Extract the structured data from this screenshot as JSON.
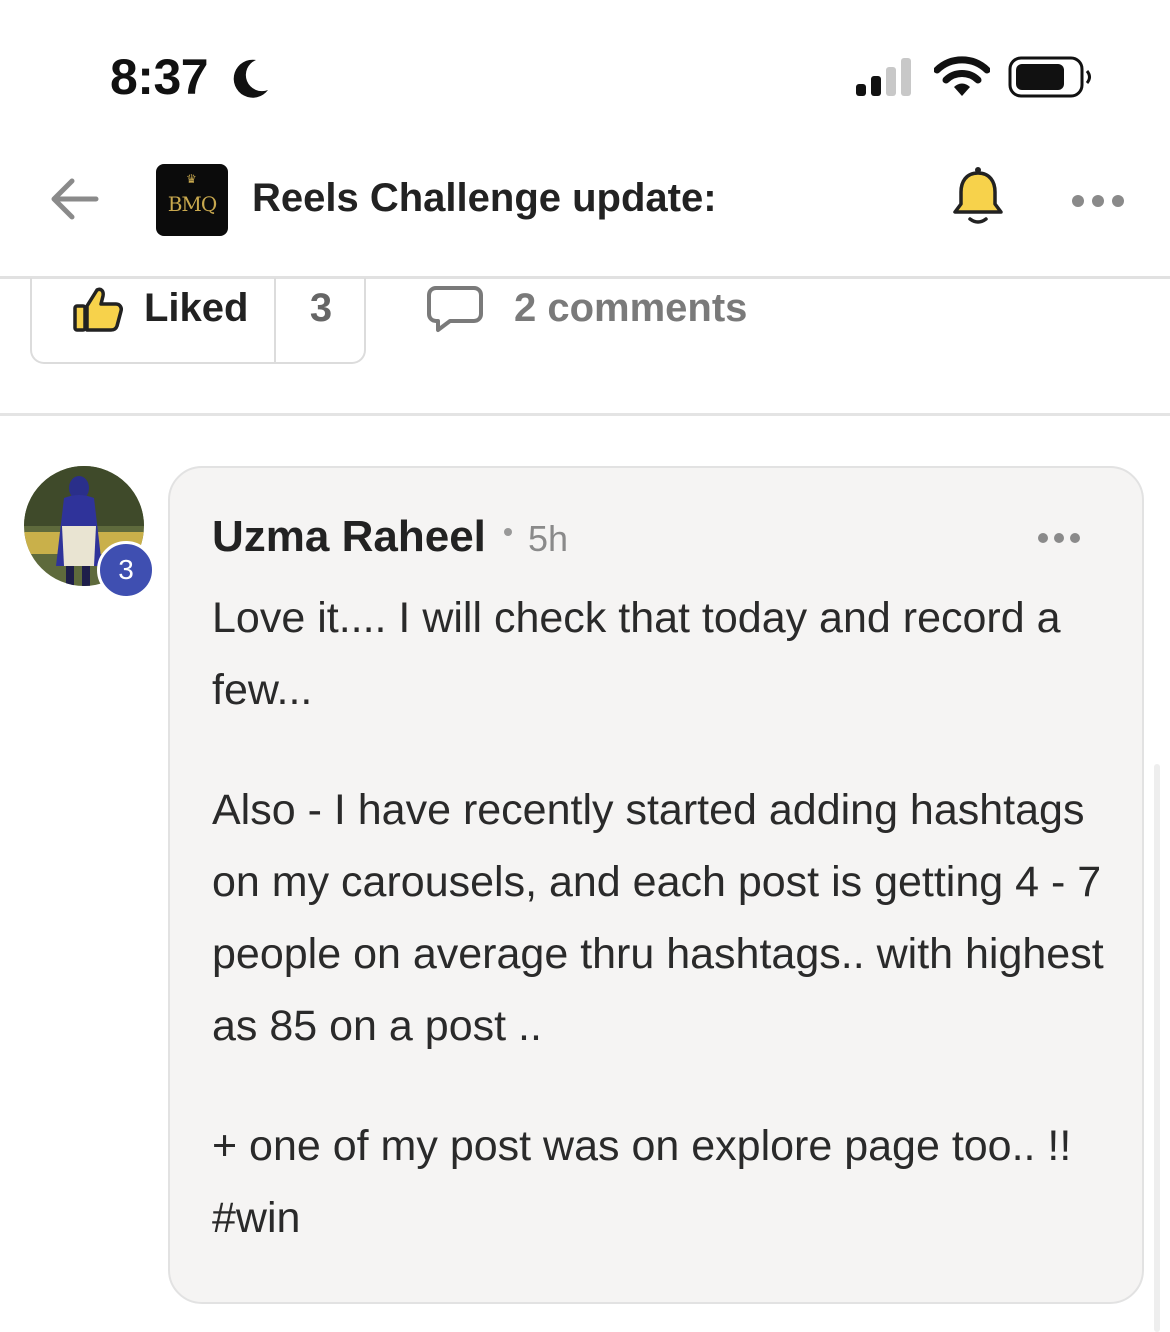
{
  "status_bar": {
    "time": "8:37",
    "icons": [
      "moon-icon",
      "signal-icon",
      "wifi-icon",
      "battery-icon"
    ]
  },
  "header": {
    "logo_text": "BMQ",
    "title": "Reels Challenge update:",
    "icons": [
      "back-arrow-icon",
      "bell-icon",
      "more-icon"
    ],
    "bell_color": "#f7d24b"
  },
  "actions": {
    "like_label": "Liked",
    "like_count": "3",
    "comments_label": "2 comments",
    "thumb_color": "#f7d24b"
  },
  "comment": {
    "author": "Uzma Raheel",
    "time": "5h",
    "level": "3",
    "level_color": "#3f4fb1",
    "paragraphs": [
      "Love it.... I will check that today and record a few...",
      "Also - I have recently started adding hashtags on my carousels, and each post is getting 4 - 7 people on average thru hashtags.. with highest as 85 on a post ..",
      "+ one of my post was on explore page too.. !! #win"
    ]
  }
}
